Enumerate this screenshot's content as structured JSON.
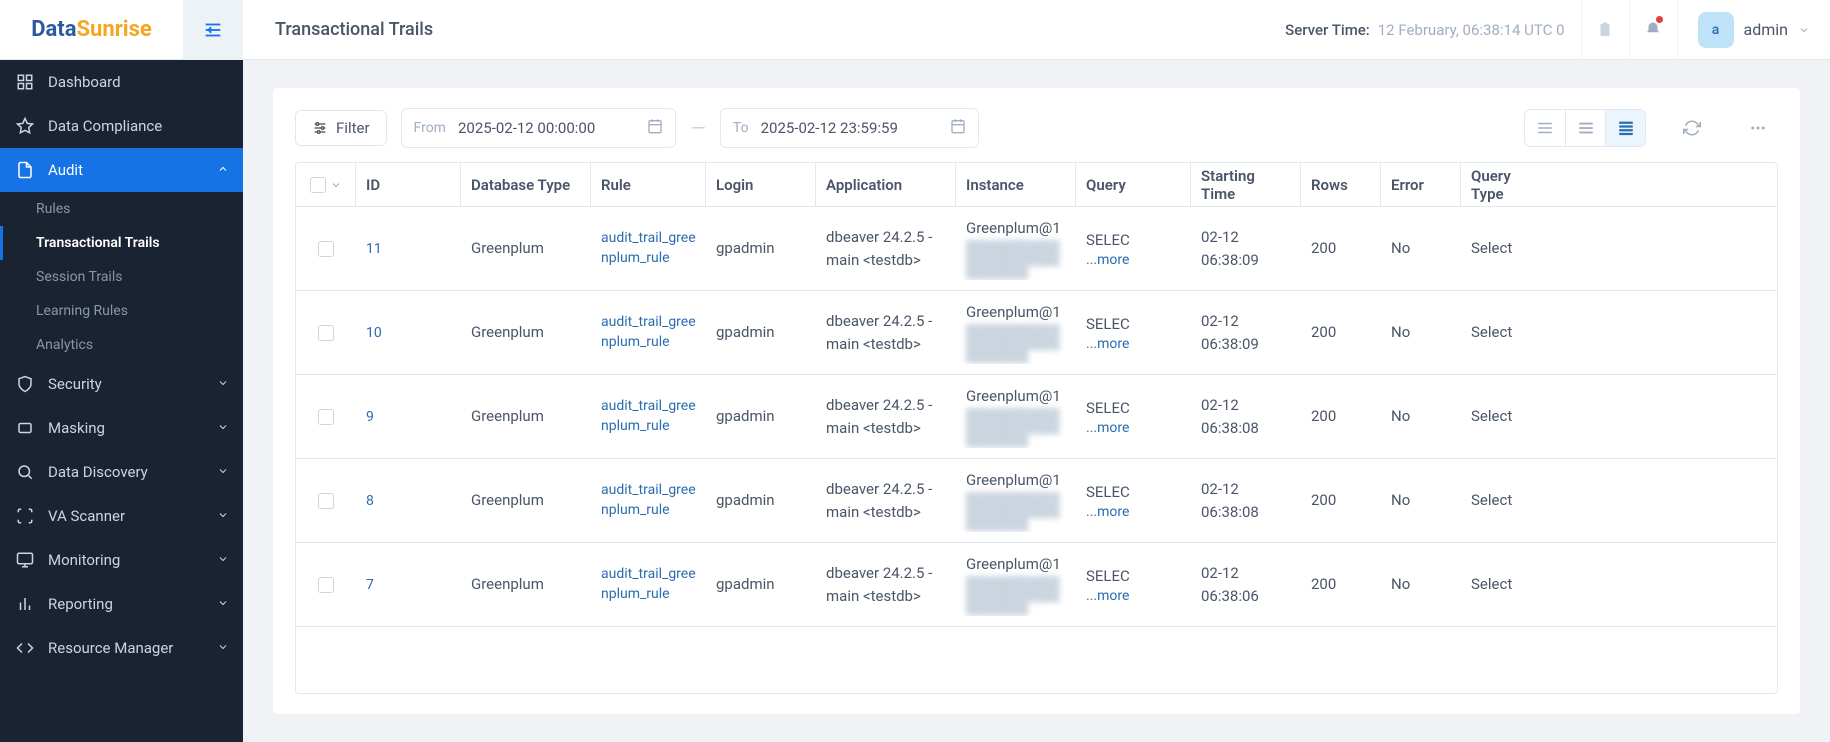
{
  "logo": {
    "part1": "Data",
    "part2": "Sunrise"
  },
  "page_title": "Transactional Trails",
  "server_time": {
    "label": "Server Time:",
    "value": "12 February, 06:38:14  UTC 0"
  },
  "user": {
    "initial": "a",
    "name": "admin"
  },
  "sidebar": {
    "items": [
      {
        "label": "Dashboard"
      },
      {
        "label": "Data Compliance"
      },
      {
        "label": "Audit"
      },
      {
        "label": "Security"
      },
      {
        "label": "Masking"
      },
      {
        "label": "Data Discovery"
      },
      {
        "label": "VA Scanner"
      },
      {
        "label": "Monitoring"
      },
      {
        "label": "Reporting"
      },
      {
        "label": "Resource Manager"
      }
    ],
    "audit_sub": [
      {
        "label": "Rules"
      },
      {
        "label": "Transactional Trails"
      },
      {
        "label": "Session Trails"
      },
      {
        "label": "Learning Rules"
      },
      {
        "label": "Analytics"
      }
    ]
  },
  "toolbar": {
    "filter_label": "Filter",
    "from_label": "From",
    "from_value": "2025-02-12 00:00:00",
    "to_label": "To",
    "to_value": "2025-02-12 23:59:59"
  },
  "columns": {
    "id": "ID",
    "db": "Database Type",
    "rule": "Rule",
    "login": "Login",
    "app": "Application",
    "inst": "Instance",
    "query": "Query",
    "time": "Starting Time",
    "rows": "Rows",
    "err": "Error",
    "qt": "Query Type"
  },
  "more_label": "...more",
  "rows": [
    {
      "id": "11",
      "db": "Greenplum",
      "rule": "audit_trail_greenplum_rule",
      "login": "gpadmin",
      "app": "dbeaver 24.2.5 - main <testdb>",
      "inst": "Greenplum@1",
      "query": "SELEC",
      "time": "02-12 06:38:09",
      "rows": "200",
      "err": "No",
      "qt": "Select"
    },
    {
      "id": "10",
      "db": "Greenplum",
      "rule": "audit_trail_greenplum_rule",
      "login": "gpadmin",
      "app": "dbeaver 24.2.5 - main <testdb>",
      "inst": "Greenplum@1",
      "query": "SELEC",
      "time": "02-12 06:38:09",
      "rows": "200",
      "err": "No",
      "qt": "Select"
    },
    {
      "id": "9",
      "db": "Greenplum",
      "rule": "audit_trail_greenplum_rule",
      "login": "gpadmin",
      "app": "dbeaver 24.2.5 - main <testdb>",
      "inst": "Greenplum@1",
      "query": "SELEC",
      "time": "02-12 06:38:08",
      "rows": "200",
      "err": "No",
      "qt": "Select"
    },
    {
      "id": "8",
      "db": "Greenplum",
      "rule": "audit_trail_greenplum_rule",
      "login": "gpadmin",
      "app": "dbeaver 24.2.5 - main <testdb>",
      "inst": "Greenplum@1",
      "query": "SELEC",
      "time": "02-12 06:38:08",
      "rows": "200",
      "err": "No",
      "qt": "Select"
    },
    {
      "id": "7",
      "db": "Greenplum",
      "rule": "audit_trail_greenplum_rule",
      "login": "gpadmin",
      "app": "dbeaver 24.2.5 - main <testdb>",
      "inst": "Greenplum@1",
      "query": "SELEC",
      "time": "02-12 06:38:06",
      "rows": "200",
      "err": "No",
      "qt": "Select"
    }
  ]
}
